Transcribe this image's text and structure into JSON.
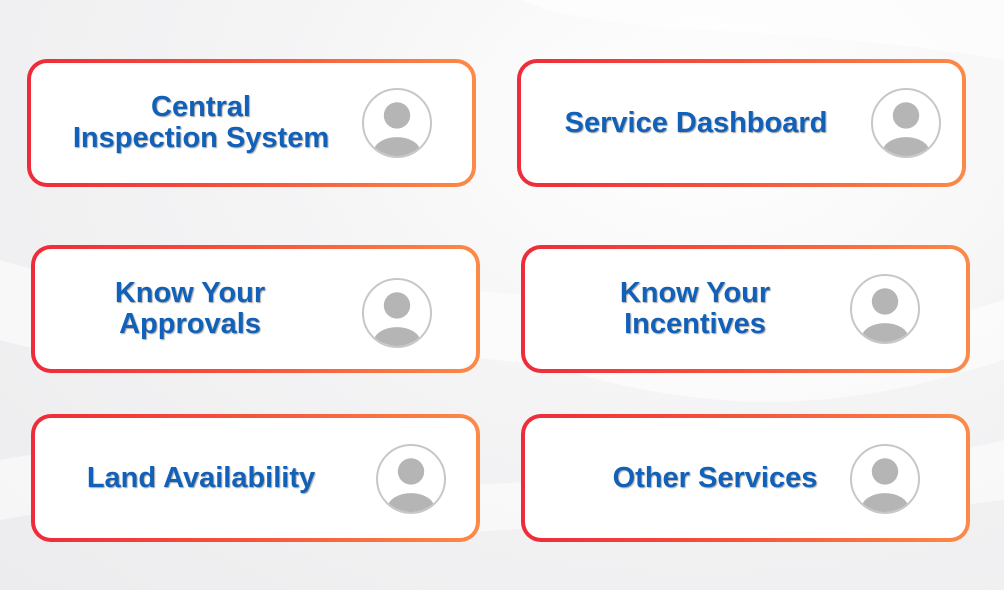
{
  "services": [
    {
      "label": "Central\nInspection System",
      "icon": "user-avatar-icon"
    },
    {
      "label": "Service Dashboard",
      "icon": "user-avatar-icon"
    },
    {
      "label": "Know Your\nApprovals",
      "icon": "user-avatar-icon"
    },
    {
      "label": "Know Your\nIncentives",
      "icon": "user-avatar-icon"
    },
    {
      "label": "Land Availability",
      "icon": "user-avatar-icon"
    },
    {
      "label": "Other Services",
      "icon": "user-avatar-icon"
    }
  ],
  "colors": {
    "label_text": "#1261b8",
    "border_start": "#ee2b3a",
    "border_end": "#fb8a48",
    "avatar_fill": "#b5b5b5",
    "avatar_ring": "#c7c7c7"
  }
}
